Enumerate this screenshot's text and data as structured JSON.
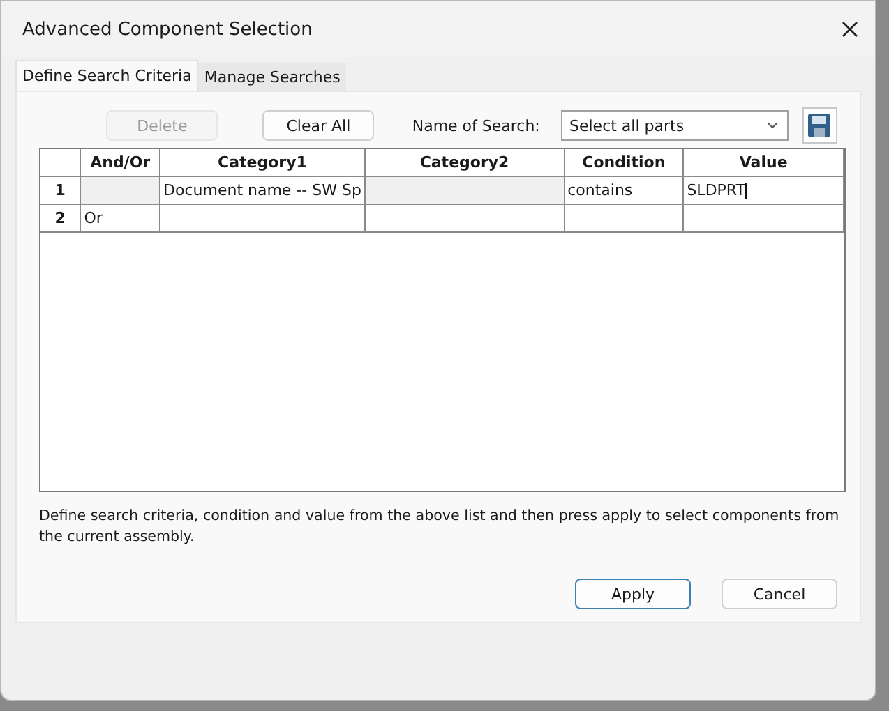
{
  "window": {
    "title": "Advanced Component Selection"
  },
  "tabs": [
    {
      "label": "Define Search Criteria",
      "selected": true
    },
    {
      "label": "Manage Searches",
      "selected": false
    }
  ],
  "toolbar": {
    "buttons": [
      {
        "label": "Delete",
        "disabled": true
      },
      {
        "label": "Clear All",
        "disabled": false
      }
    ],
    "search_name_label": "Name of Search:",
    "search_name_value": "Select all parts"
  },
  "table": {
    "columns": [
      "And/Or",
      "Category1",
      "Category2",
      "Condition",
      "Value"
    ],
    "rows": [
      {
        "number": "1",
        "cells": [
          {
            "disabled": true
          },
          {
            "text": "Document name -- SW Sp",
            "disabled": false
          },
          {
            "disabled": true
          },
          {
            "text": "contains",
            "disabled": false
          },
          {
            "text": "SLDPRT",
            "disabled": false,
            "editing": true
          }
        ]
      },
      {
        "number": "2",
        "cells": [
          {
            "text": "Or",
            "disabled": false
          },
          {
            "disabled": false
          },
          {
            "disabled": false
          },
          {
            "disabled": false
          },
          {
            "disabled": false
          }
        ]
      }
    ]
  },
  "description": "Define search criteria, condition and value from the above list and then press apply to select components from the current assembly.",
  "buttons": [
    {
      "label": "Apply",
      "default": true
    },
    {
      "label": "Cancel",
      "default": false
    }
  ]
}
